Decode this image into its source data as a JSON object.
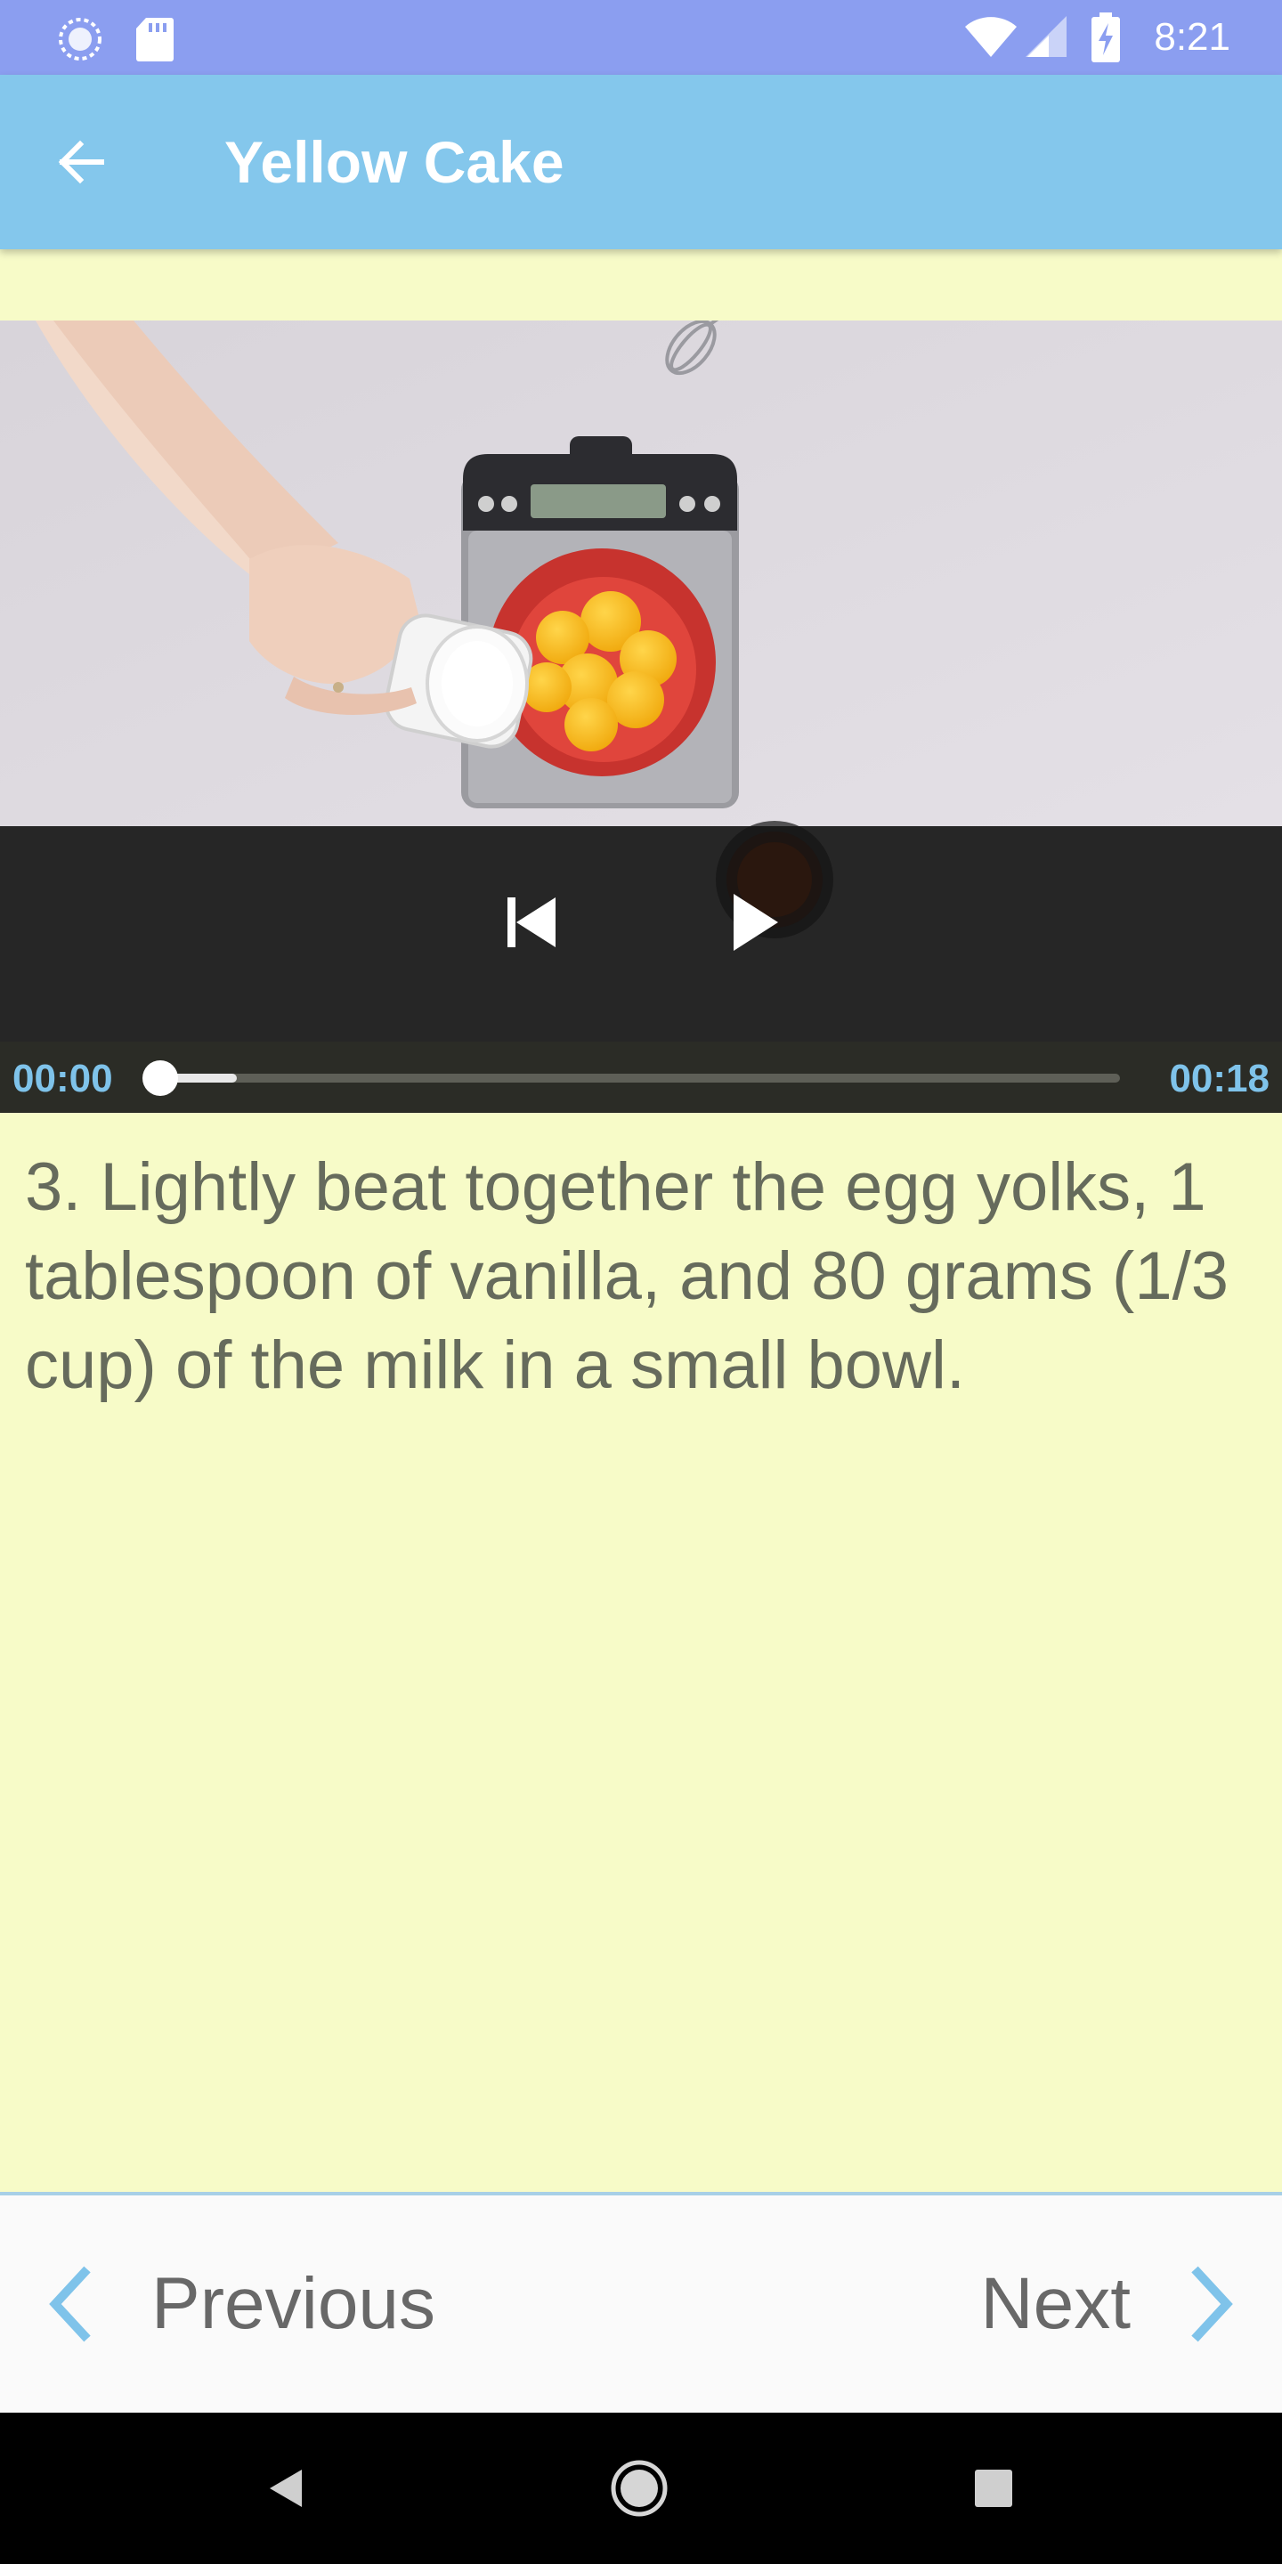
{
  "status_bar": {
    "time": "8:21",
    "icons": [
      "sync-icon",
      "sd-card-icon",
      "wifi-icon",
      "cell-signal-icon",
      "battery-charging-icon"
    ]
  },
  "app_bar": {
    "title": "Yellow Cake",
    "back_icon": "arrow-back-icon"
  },
  "video_player": {
    "elapsed": "00:00",
    "duration": "00:18",
    "progress_fraction": 0.0,
    "buffered_fraction": 0.08,
    "controls": [
      "skip-previous-icon",
      "play-icon"
    ]
  },
  "step": {
    "text": "3. Lightly beat together the egg yolks, 1 tablespoon of vanilla, and 80 grams (1/3 cup) of the milk in a small bowl."
  },
  "navigation": {
    "previous_label": "Previous",
    "next_label": "Next"
  },
  "colors": {
    "status_bar": "#8b9ef0",
    "app_bar": "#84c7ec",
    "background": "#f7fbc8",
    "accent": "#7fc3ea",
    "step_text": "#666b5c"
  }
}
